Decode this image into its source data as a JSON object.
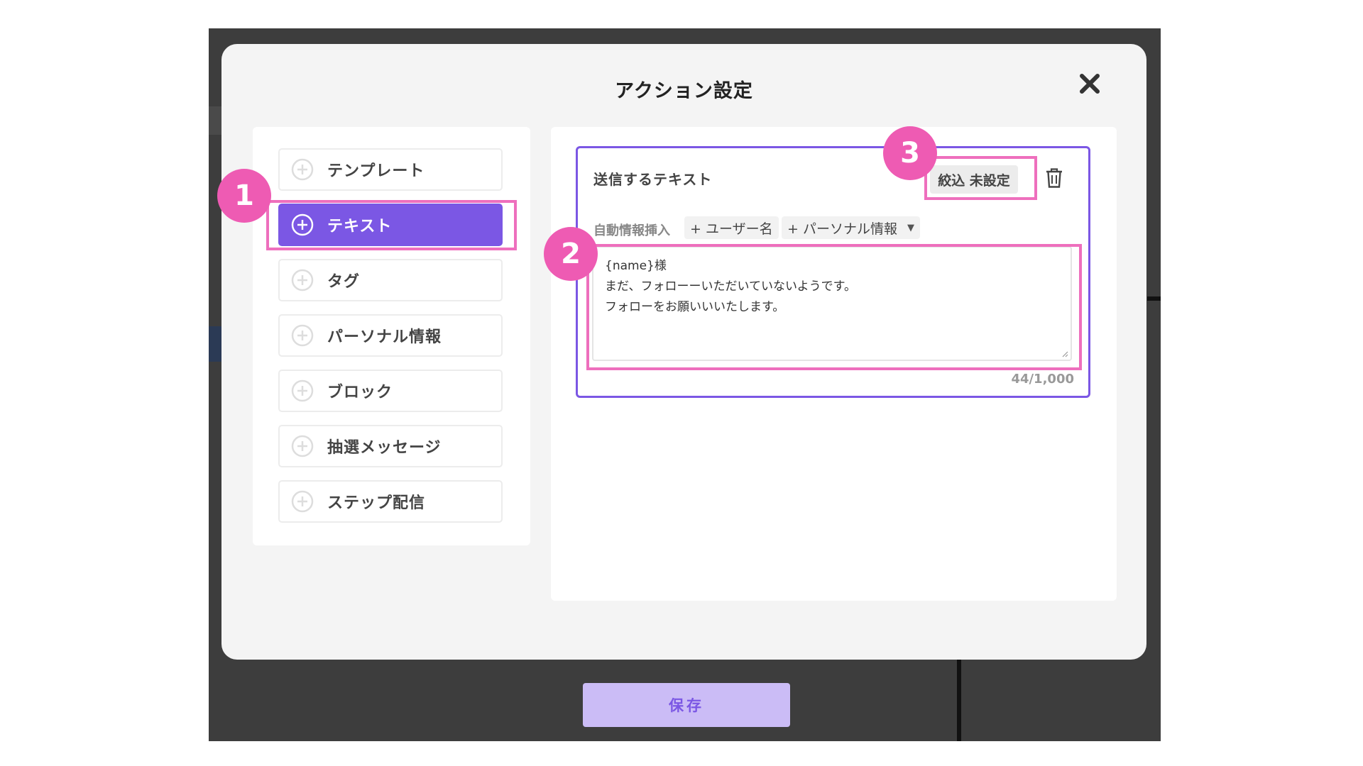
{
  "modal": {
    "title": "アクション設定",
    "close_icon": "close-icon"
  },
  "menu": {
    "items": [
      {
        "label": "テンプレート",
        "active": false
      },
      {
        "label": "テキスト",
        "active": true
      },
      {
        "label": "タグ",
        "active": false
      },
      {
        "label": "パーソナル情報",
        "active": false
      },
      {
        "label": "ブロック",
        "active": false
      },
      {
        "label": "抽選メッセージ",
        "active": false
      },
      {
        "label": "ステップ配信",
        "active": false
      }
    ]
  },
  "card": {
    "title": "送信するテキスト",
    "filter_label": "絞込 未設定",
    "auto_insert_label": "自動情報挿入",
    "chip_username": "+ ユーザー名",
    "chip_personal": "+ パーソナル情報",
    "message_lines": [
      "{name}様",
      "まだ、フォローーいただいていないようです。",
      "フォローをお願いいいたします。"
    ],
    "counter": "44/1,000"
  },
  "badges": [
    "1",
    "2",
    "3"
  ],
  "save_label": "保存",
  "colors": {
    "accent": "#7b57e4",
    "highlight": "#ee6fbd",
    "badge": "#ee5bb3",
    "save_bg": "#cbbcf6"
  }
}
